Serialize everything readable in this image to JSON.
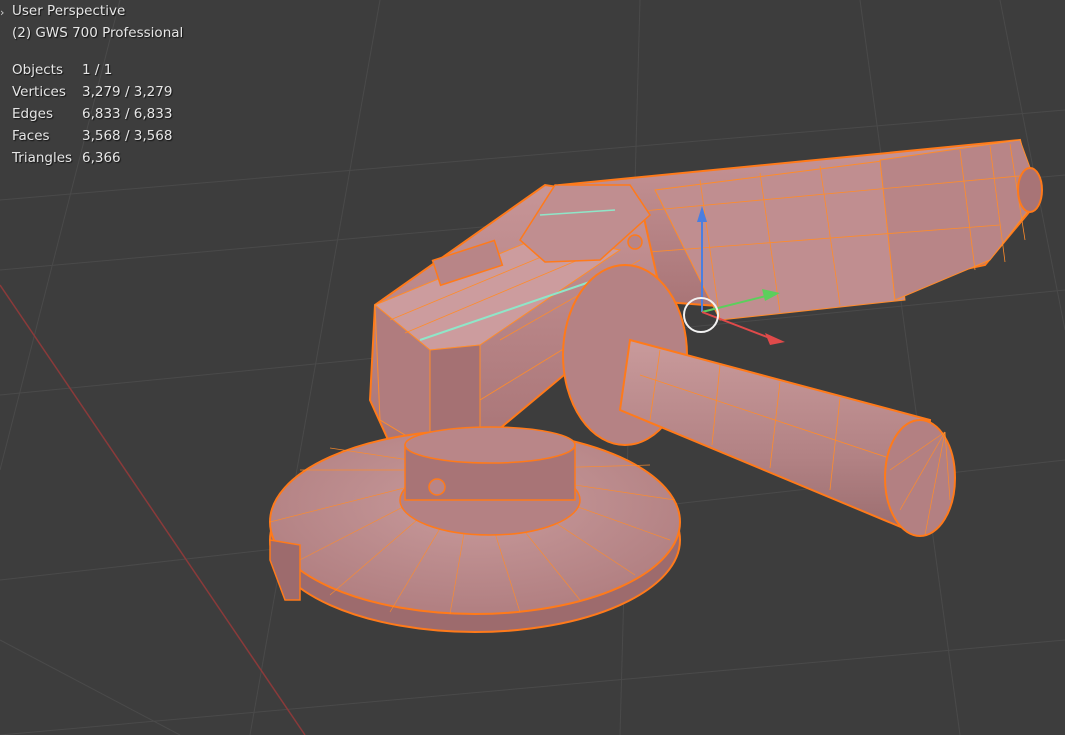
{
  "viewport": {
    "view_name": "User Perspective",
    "object_name": "(2) GWS 700 Professional",
    "background_color": "#3d3d3d",
    "selection_color": "#ff7a1a",
    "mesh_color": "#b88586"
  },
  "stats": [
    {
      "label": "Objects",
      "value": "1 / 1"
    },
    {
      "label": "Vertices",
      "value": "3,279 / 3,279"
    },
    {
      "label": "Edges",
      "value": "6,833 / 6,833"
    },
    {
      "label": "Faces",
      "value": "3,568 / 3,568"
    },
    {
      "label": "Triangles",
      "value": "6,366"
    }
  ],
  "icons": {
    "expand": "chevron-right-icon",
    "gizmo_x": "x-axis-arrow-icon",
    "gizmo_y": "y-axis-arrow-icon",
    "gizmo_z": "z-axis-arrow-icon",
    "cursor": "3d-cursor-icon"
  }
}
